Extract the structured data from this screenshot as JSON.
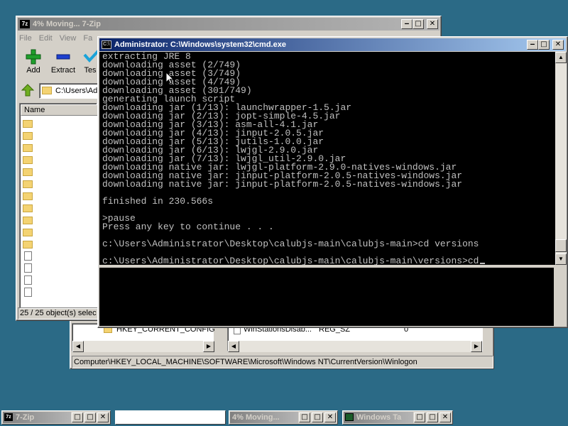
{
  "zip_window": {
    "title": "4% Moving... 7-Zip",
    "menu": [
      "File",
      "Edit",
      "View",
      "Fa"
    ],
    "toolbar": {
      "add": "Add",
      "extract": "Extract",
      "test": "Tes"
    },
    "address": "C:\\Users\\Ad",
    "column_name": "Name",
    "status": "25 / 25 object(s) selec"
  },
  "regedit": {
    "tree_item": "HKEY_CURRENT_CONFIG",
    "list_name": "WinStationsDisab...",
    "list_type": "REG_SZ",
    "list_data": "0",
    "statusbar": "Computer\\HKEY_LOCAL_MACHINE\\SOFTWARE\\Microsoft\\Windows NT\\CurrentVersion\\Winlogon"
  },
  "cmd_window": {
    "title": "Administrator: C:\\Windows\\system32\\cmd.exe",
    "lines": [
      "extracting JRE 8",
      "downloading asset (2/749)",
      "downloading asset (3/749)",
      "downloading asset (4/749)",
      "downloading asset (301/749)",
      "generating launch script",
      "downloading jar (1/13): launchwrapper-1.5.jar",
      "downloading jar (2/13): jopt-simple-4.5.jar",
      "downloading jar (3/13): asm-all-4.1.jar",
      "downloading jar (4/13): jinput-2.0.5.jar",
      "downloading jar (5/13): jutils-1.0.0.jar",
      "downloading jar (6/13): lwjgl-2.9.0.jar",
      "downloading jar (7/13): lwjgl_util-2.9.0.jar",
      "downloading native jar: lwjgl-platform-2.9.0-natives-windows.jar",
      "downloading native jar: jinput-platform-2.0.5-natives-windows.jar",
      "downloading native jar: jinput-platform-2.0.5-natives-windows.jar",
      "",
      "finished in 230.566s",
      "",
      ">pause",
      "Press any key to continue . . .",
      "",
      "c:\\Users\\Administrator\\Desktop\\calubjs-main\\calubjs-main>cd versions",
      "",
      "c:\\Users\\Administrator\\Desktop\\calubjs-main\\calubjs-main\\versions>cd"
    ]
  },
  "taskbar": [
    {
      "title": "7-Zip"
    },
    {
      "title": ""
    },
    {
      "title": "4% Moving..."
    },
    {
      "title": "Windows Ta"
    }
  ],
  "controls": {
    "minimize": "‒",
    "restore": "□",
    "close": "✕"
  },
  "colors": {
    "desktop": "#2b6a86",
    "titlebar_active": "#0a246a",
    "titlebar_inactive": "#808080",
    "console_bg": "#000000",
    "console_fg": "#c0c0c0"
  }
}
